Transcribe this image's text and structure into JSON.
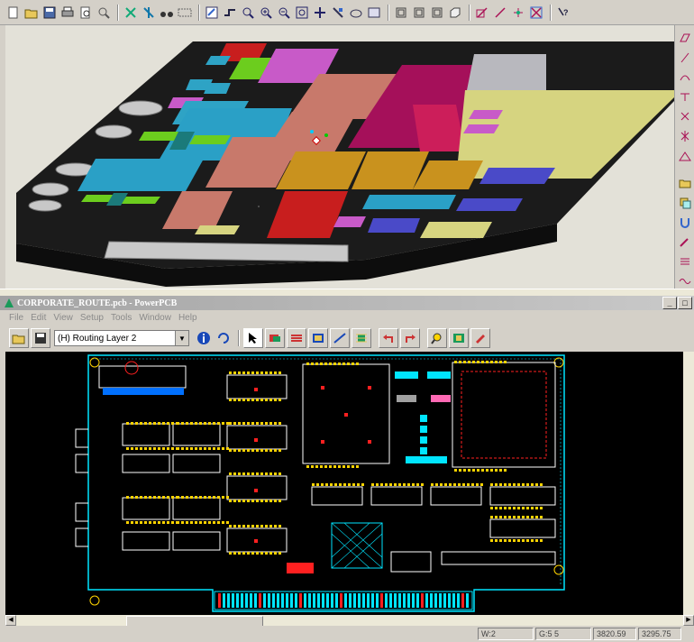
{
  "window": {
    "title": "CORPORATE_ROUTE.pcb - PowerPCB",
    "minimize_label": "_",
    "maximize_label": "□"
  },
  "menu": {
    "items": [
      "File",
      "Edit",
      "View",
      "Setup",
      "Tools",
      "Window",
      "Help"
    ]
  },
  "toolbar": {
    "layer_select_value": "(H) Routing Layer 2"
  },
  "status": {
    "width": "W:2",
    "grid": "G:5 5",
    "x": "3820.59",
    "y": "3295.75"
  },
  "colors": {
    "board_3d": "#1b1b1b",
    "pcb_background": "#000000",
    "board_outline": "#00e5ff",
    "pad": "#ffd400",
    "trace_red": "#ff2020",
    "component_outline": "#ffffff"
  },
  "icons": {
    "top_toolbar": [
      "new-icon",
      "open-icon",
      "save-icon",
      "print-icon",
      "preview-icon",
      "find-icon",
      "ratsnest-icon",
      "ratsnest2-icon",
      "binoculars-icon",
      "layers-icon",
      "select-icon",
      "route-icon",
      "zoom-window-icon",
      "zoom-in-icon",
      "zoom-out-icon",
      "zoom-fit-icon",
      "pan-icon",
      "pick-icon",
      "layer-icon",
      "export-icon",
      "view-front-icon",
      "view-back-icon",
      "view-side-icon",
      "view-3d-icon",
      "draw-icon",
      "measure-icon",
      "snap-icon",
      "grid-icon",
      "help-icon"
    ],
    "bottom_toolbar": [
      "open-folder-icon",
      "save-icon",
      "info-icon",
      "refresh-icon",
      "select-arrow-icon",
      "route-icon",
      "bus-icon",
      "component-icon",
      "trace-icon",
      "pad-icon",
      "undo-icon",
      "redo-icon",
      "zoom-icon",
      "layout-icon",
      "eraser-icon"
    ]
  }
}
